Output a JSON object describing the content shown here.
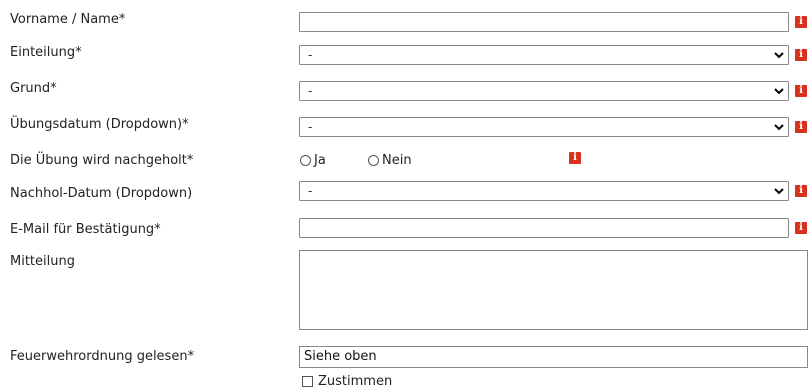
{
  "form": {
    "name": {
      "label": "Vorname / Name*",
      "value": ""
    },
    "einteilung": {
      "label": "Einteilung*",
      "selected": "-"
    },
    "grund": {
      "label": "Grund*",
      "selected": "-"
    },
    "uebungsdatum": {
      "label": "Übungsdatum (Dropdown)*",
      "selected": "-"
    },
    "nachgeholt": {
      "label": "Die Übung wird nachgeholt*",
      "options": [
        "Ja",
        "Nein"
      ]
    },
    "nachhol_datum": {
      "label": "Nachhol-Datum (Dropdown)",
      "selected": "-"
    },
    "email": {
      "label": "E-Mail für Bestätigung*",
      "value": ""
    },
    "mitteilung": {
      "label": "Mitteilung",
      "value": ""
    },
    "feuerwehrordnung": {
      "label": "Feuerwehrordnung gelesen*",
      "value": "Siehe oben",
      "checkbox_label": "Zustimmen"
    }
  },
  "icons": {
    "info": "info-icon",
    "info_glyph": "i",
    "chevron": "chevron-down-icon"
  },
  "colors": {
    "info_badge": "#d8321e",
    "border": "#8a8a8a"
  }
}
